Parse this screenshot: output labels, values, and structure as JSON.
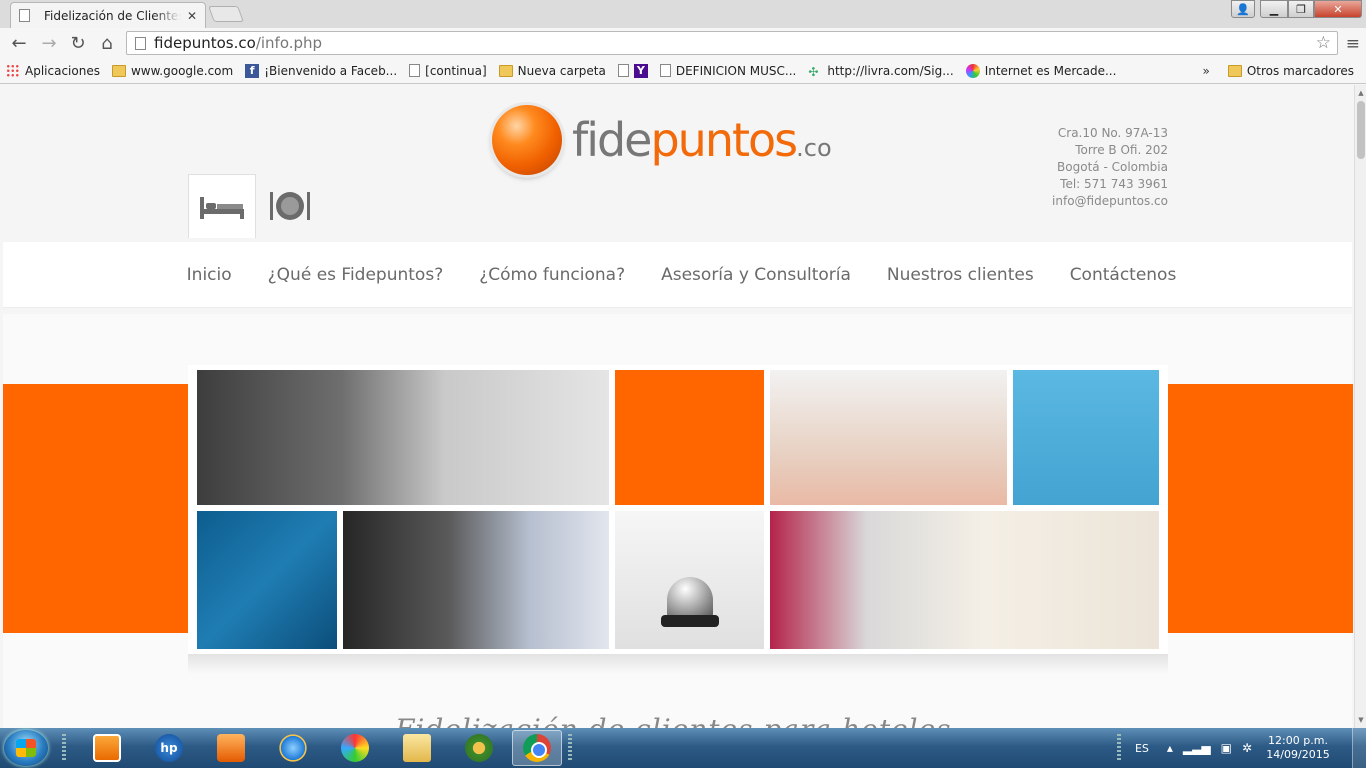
{
  "browser": {
    "tab_title": "Fidelización de Clientes de",
    "tab_close": "✕",
    "url_host": "fidepuntos.co",
    "url_path": "/info.php",
    "bookmarks": [
      {
        "label": "Aplicaciones",
        "icon": "apps-grid-icon"
      },
      {
        "label": "www.google.com",
        "icon": "folder-icon"
      },
      {
        "label": "¡Bienvenido a Faceb...",
        "icon": "facebook-icon"
      },
      {
        "label": "[continua]",
        "icon": "page-icon"
      },
      {
        "label": "Nueva carpeta",
        "icon": "folder-icon"
      },
      {
        "label": "",
        "icon": "yahoo-icon"
      },
      {
        "label": "DEFINICION MUSC...",
        "icon": "page-icon"
      },
      {
        "label": "http://livra.com/Sig...",
        "icon": "livra-icon"
      },
      {
        "label": "Internet es Mercade...",
        "icon": "globe-icon"
      }
    ],
    "bookmarks_more": "»",
    "other_bookmarks": "Otros marcadores"
  },
  "site": {
    "logo": {
      "fide": "fide",
      "puntos": "puntos",
      "co": ".co"
    },
    "contact": {
      "line1": "Cra.10 No. 97A-13",
      "line2": "Torre B Ofi. 202",
      "line3": "Bogotá - Colombia",
      "line4": "Tel: 571 743 3961",
      "line5": "info@fidepuntos.co"
    },
    "nav": [
      "Inicio",
      "¿Qué es Fidepuntos?",
      "¿Cómo funciona?",
      "Asesoría y Consultoría",
      "Nuestros clientes",
      "Contáctenos"
    ],
    "headline": "Fidelización de clientes para hoteles"
  },
  "taskbar": {
    "lang": "ES",
    "time": "12:00 p.m.",
    "date": "14/09/2015"
  },
  "colors": {
    "brand_orange": "#ff6600",
    "accent_blue": "#45a3d2"
  }
}
